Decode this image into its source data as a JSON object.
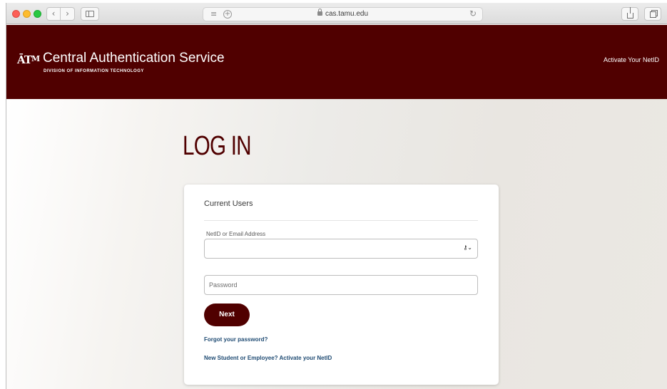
{
  "browser": {
    "url": "cas.tamu.edu",
    "back_glyph": "‹",
    "forward_glyph": "›",
    "reader_glyph": "≡",
    "plus_glyph": "+",
    "reload_glyph": "↻",
    "icons": [
      "chevron-left-icon",
      "chevron-right-icon",
      "sidebar-icon",
      "reader-icon",
      "plus-icon",
      "lock-icon",
      "reload-icon",
      "share-icon",
      "tabs-icon"
    ]
  },
  "header": {
    "logo_main": "ĀT",
    "logo_small": "M",
    "title": "Central Authentication Service",
    "subtitle": "DIVISION OF INFORMATION TECHNOLOGY",
    "activate_link": "Activate Your NetID",
    "background_color": "#500000"
  },
  "main": {
    "heading": "LOG IN",
    "card": {
      "heading": "Current Users",
      "netid_label": "NetID or Email Address",
      "netid_value": "",
      "key_glyph": "⚷⌄",
      "password_placeholder": "Password",
      "next_button": "Next",
      "forgot_link": "Forgot your password?",
      "activate_link": "New Student or Employee? Activate your NetID"
    }
  },
  "colors": {
    "maroon": "#500000",
    "link": "#1f4b73"
  }
}
